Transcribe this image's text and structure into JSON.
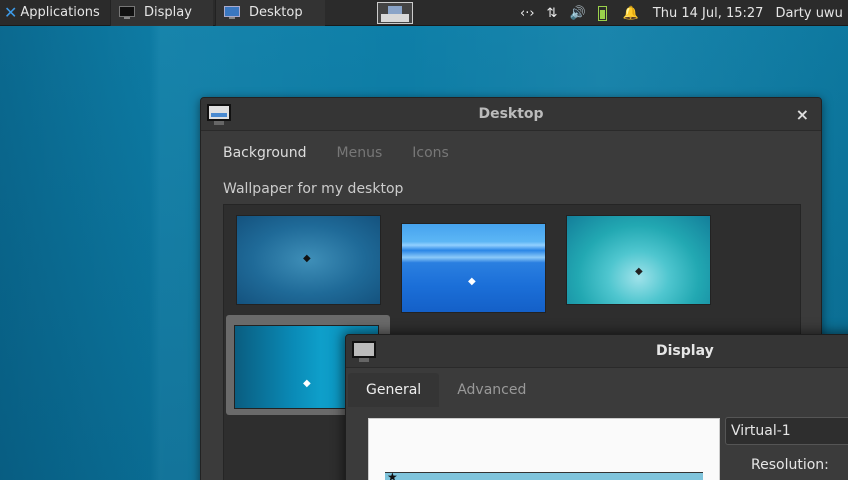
{
  "panel": {
    "applications_label": "Applications",
    "tasks": [
      {
        "label": "Display"
      },
      {
        "label": "Desktop"
      }
    ],
    "tray": {
      "network_glyph": "‹·›",
      "transfer_glyph": "⇅",
      "volume_glyph": "🔊",
      "bell_glyph": "🔔"
    },
    "clock": "Thu 14 Jul, 15:27",
    "user": "Darty uwu"
  },
  "desktop_window": {
    "title": "Desktop",
    "close_glyph": "×",
    "tabs": [
      "Background",
      "Menus",
      "Icons"
    ],
    "section_label": "Wallpaper for my desktop"
  },
  "display_window": {
    "title": "Display",
    "tabs": [
      "General",
      "Advanced"
    ],
    "output_value": "Virtual-1",
    "resolution_label": "Resolution:"
  },
  "colors": {
    "panel_bg": "#2b2b2b",
    "window_bg": "#3b3b3b",
    "accent_blue": "#3d9be9"
  }
}
